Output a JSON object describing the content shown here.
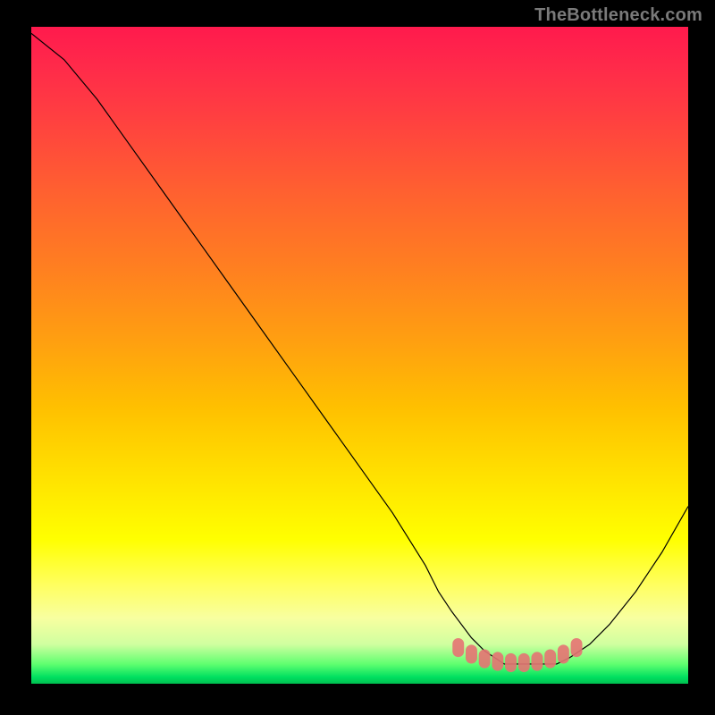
{
  "watermark_text": "TheBottleneck.com",
  "chart_data": {
    "type": "line",
    "title": "",
    "xlabel": "",
    "ylabel": "",
    "xlim": [
      0,
      100
    ],
    "ylim": [
      0,
      100
    ],
    "grid": false,
    "legend": false,
    "series": [
      {
        "name": "curve",
        "color": "#000000",
        "x": [
          0,
          5,
          10,
          15,
          20,
          25,
          30,
          35,
          40,
          45,
          50,
          55,
          60,
          62,
          64,
          67,
          69,
          72,
          74,
          76,
          78,
          80,
          82,
          85,
          88,
          92,
          96,
          100
        ],
        "y": [
          99,
          95,
          89,
          82,
          75,
          68,
          61,
          54,
          47,
          40,
          33,
          26,
          18,
          14,
          11,
          7,
          5,
          3,
          3,
          3,
          3,
          3,
          4,
          6,
          9,
          14,
          20,
          27
        ]
      }
    ],
    "markers": {
      "name": "highlighted-zone",
      "color": "#e57373",
      "x": [
        65,
        67,
        69,
        71,
        73,
        75,
        77,
        79,
        81,
        83
      ],
      "y": [
        5.5,
        4.5,
        3.8,
        3.4,
        3.2,
        3.2,
        3.4,
        3.8,
        4.5,
        5.5
      ],
      "marker_style": "pill",
      "marker_size_pct": 1.6
    },
    "gradient_stops": [
      {
        "pos": 0.0,
        "color": "#ff1a4d"
      },
      {
        "pos": 0.25,
        "color": "#ff6030"
      },
      {
        "pos": 0.5,
        "color": "#ffb000"
      },
      {
        "pos": 0.75,
        "color": "#ffff00"
      },
      {
        "pos": 0.95,
        "color": "#80ff80"
      },
      {
        "pos": 1.0,
        "color": "#00c050"
      }
    ]
  }
}
